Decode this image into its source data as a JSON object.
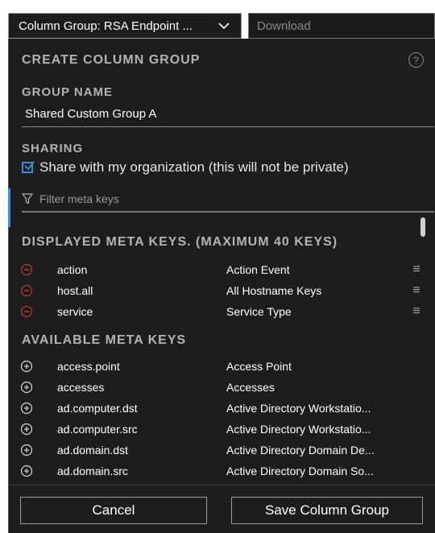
{
  "toolbar": {
    "column_group_label": "Column Group: RSA Endpoint ...",
    "download_label": "Download"
  },
  "panel": {
    "title": "CREATE COLUMN GROUP",
    "help_glyph": "?",
    "group_name_heading": "GROUP NAME",
    "group_name_value": "Shared Custom Group A",
    "sharing_heading": "SHARING",
    "share_label": "Share with my organization (this will not be private)",
    "share_checked": true,
    "filter_placeholder": "Filter meta keys",
    "displayed_heading": "DISPLAYED META KEYS. (MAXIMUM 40 KEYS)",
    "displayed_keys": [
      {
        "name": "action",
        "description": "Action Event"
      },
      {
        "name": "host.all",
        "description": "All Hostname Keys"
      },
      {
        "name": "service",
        "description": "Service Type"
      }
    ],
    "available_heading": "AVAILABLE META KEYS",
    "available_keys": [
      {
        "name": "access.point",
        "description": "Access Point"
      },
      {
        "name": "accesses",
        "description": "Accesses"
      },
      {
        "name": "ad.computer.dst",
        "description": "Active Directory Workstatio..."
      },
      {
        "name": "ad.computer.src",
        "description": "Active Directory Workstatio..."
      },
      {
        "name": "ad.domain.dst",
        "description": "Active Directory Domain De..."
      },
      {
        "name": "ad.domain.src",
        "description": "Active Directory Domain So..."
      }
    ],
    "cancel_label": "Cancel",
    "save_label": "Save Column Group"
  },
  "colors": {
    "panel_bg": "#1d1d1d",
    "accent_blue": "#3a8fd8",
    "remove_red": "#c0392b"
  }
}
